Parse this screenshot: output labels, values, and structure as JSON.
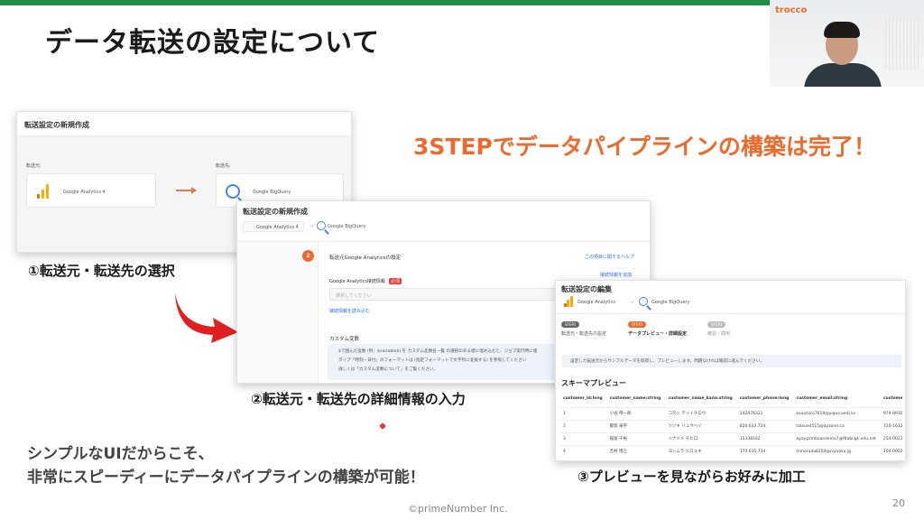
{
  "slide": {
    "title": "データ転送の設定について",
    "headline": "3STEPでデータパイプラインの構築は完了！",
    "footer_line1": "シンプルなUIだからこそ、",
    "footer_line2": "非常にスピーディーにデータパイプラインの構築が可能！",
    "copyright": "©primeNumber Inc.",
    "page_number": "20",
    "brand": "trocco",
    "colors": {
      "accent": "#ec6a2c",
      "topbar": "#1f8f46"
    }
  },
  "step1": {
    "label": "①転送元・転送先の選択",
    "card_title": "転送設定の新規作成",
    "source_caption": "転送元:",
    "dest_caption": "転送先:",
    "source_name": "Google Analytics 4",
    "dest_name": "Google BigQuery"
  },
  "step2": {
    "label": "②転送元・転送先の詳細情報の入力",
    "card_title": "転送設定の新規作成",
    "crumb_source": "Google Analytics 4",
    "crumb_dest": "Google BigQuery",
    "step_number": "2",
    "section_title": "転送元Google Analyticsの設定",
    "help_link": "この項目に関するヘルプ",
    "refresh_link": "接続情報を追加",
    "conn_label": "Google Analytics接続情報",
    "required": "必須",
    "placeholder": "選択してください",
    "load_link": "接続情報を読み込む",
    "custom_title": "カスタム変数",
    "custom_line1": "$で囲んだ変数 (例：$variable$) を カスタム変数名一覧 の選択のある値に埋め込むと、ジョブ実行時に値",
    "custom_line2": "タイプ「時刻・日付」のフォーマットは (指定フォーマットで文字列に変換する) を参照してください",
    "custom_line3": "詳しくは「カスタム変数について」をご覧ください。"
  },
  "step3": {
    "label": "③プレビューを見ながらお好みに加工",
    "card_title": "転送設定の編集",
    "source_name": "Google Analytics",
    "dest_name": "Google BigQuery",
    "steps": [
      {
        "badge": "STEP1",
        "text": "転送元・転送先の設定"
      },
      {
        "badge": "STEP2",
        "text": "データプレビュー・詳細設定"
      },
      {
        "badge": "STEP3",
        "text": "確認・適用"
      }
    ],
    "notice": "設定した転送元からサンプルデータを取得し、プレビューします。問題なければ確認に進んでください。",
    "preview_title": "スキーマプレビュー",
    "columns": [
      "customer_id:long",
      "customer_name:string",
      "customer_name_kana:string",
      "customer_phone:long",
      "customer_email:string",
      "customer_fzak:string"
    ],
    "rows": [
      [
        "1",
        "小谷 帝一郎",
        "コタニ テイイチロウ",
        "242476321",
        "kouichiro7619@yiqus.ae4j.kc",
        "974-8930"
      ],
      [
        "2",
        "都筑 竜平",
        "ツヅキ リュウヘイ",
        "820.622.724",
        "tatsue4515@ayzorer.ca",
        "720-1612"
      ],
      [
        "3",
        "稲留 千裕",
        "イナドメ チヒロ",
        "15338162",
        "ayay.prmbaanokmo7@f8abiigk.edu.net",
        "254-0023"
      ],
      [
        "4",
        "吉村 博之",
        "ヨシムラ ヒロユキ",
        "173.635.734",
        "minoruda8254@niyoaka.jg",
        "204-0002"
      ]
    ]
  }
}
